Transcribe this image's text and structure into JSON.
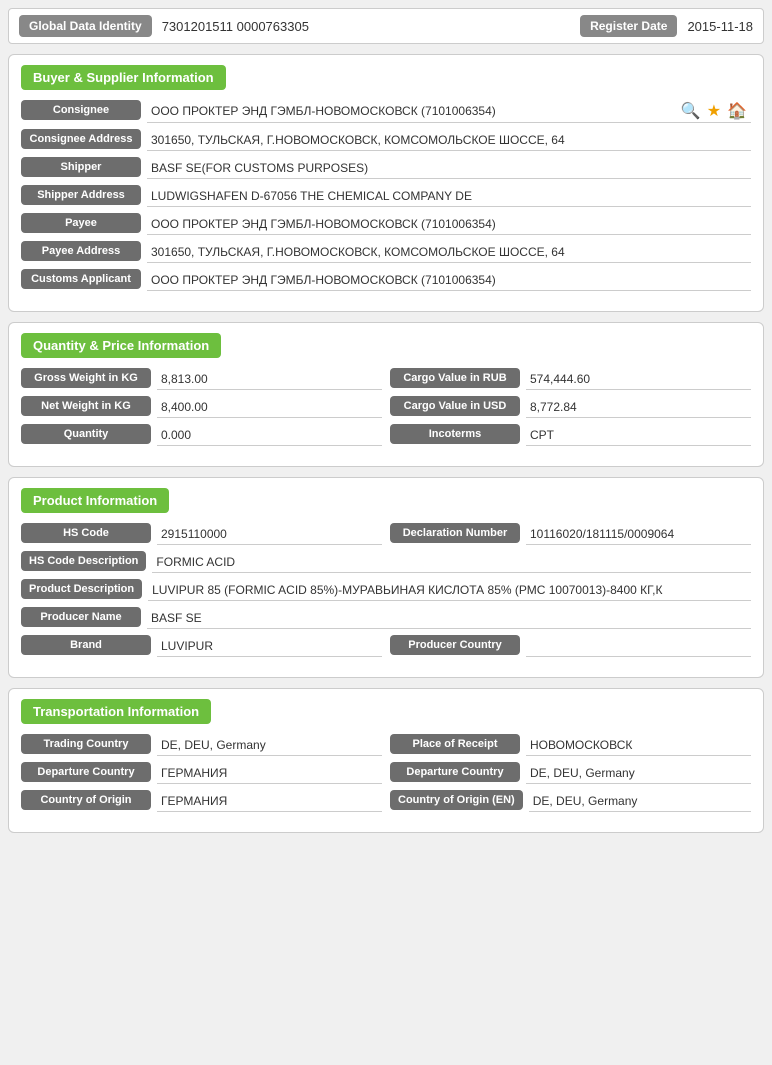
{
  "topBar": {
    "globalDataIdentityLabel": "Global Data Identity",
    "globalDataIdentityValue": "7301201511 0000763305",
    "registerDateLabel": "Register Date",
    "registerDateValue": "2015-11-18"
  },
  "buyerSupplier": {
    "sectionTitle": "Buyer & Supplier Information",
    "fields": [
      {
        "label": "Consignee",
        "value": "ООО ПРОКТЕР ЭНД ГЭМБЛ-НОВОМОСКОВСК (7101006354)"
      },
      {
        "label": "Consignee Address",
        "value": "301650, ТУЛЬСКАЯ, Г.НОВОМОСКОВСК, КОМСОМОЛЬСКОЕ ШОССЕ, 64"
      },
      {
        "label": "Shipper",
        "value": "BASF SE(FOR CUSTOMS PURPOSES)"
      },
      {
        "label": "Shipper Address",
        "value": "LUDWIGSHAFEN D-67056 THE CHEMICAL COMPANY DE"
      },
      {
        "label": "Payee",
        "value": "ООО ПРОКТЕР ЭНД ГЭМБЛ-НОВОМОСКОВСК (7101006354)"
      },
      {
        "label": "Payee Address",
        "value": "301650, ТУЛЬСКАЯ, Г.НОВОМОСКОВСК, КОМСОМОЛЬСКОЕ ШОССЕ, 64"
      },
      {
        "label": "Customs Applicant",
        "value": "ООО ПРОКТЕР ЭНД ГЭМБЛ-НОВОМОСКОВСК (7101006354)"
      }
    ]
  },
  "quantityPrice": {
    "sectionTitle": "Quantity & Price Information",
    "leftFields": [
      {
        "label": "Gross Weight in KG",
        "value": "8,813.00"
      },
      {
        "label": "Net Weight in KG",
        "value": "8,400.00"
      },
      {
        "label": "Quantity",
        "value": "0.000"
      }
    ],
    "rightFields": [
      {
        "label": "Cargo Value in RUB",
        "value": "574,444.60"
      },
      {
        "label": "Cargo Value in USD",
        "value": "8,772.84"
      },
      {
        "label": "Incoterms",
        "value": "CPT"
      }
    ]
  },
  "productInfo": {
    "sectionTitle": "Product Information",
    "topRow": {
      "leftLabel": "HS Code",
      "leftValue": "2915110000",
      "rightLabel": "Declaration Number",
      "rightValue": "10116020/181115/0009064"
    },
    "fields": [
      {
        "label": "HS Code Description",
        "value": "FORMIC ACID"
      },
      {
        "label": "Product Description",
        "value": "LUVIPUR 85 (FORMIC ACID 85%)-МУРАВЬИНАЯ КИСЛОТА 85% (РМС 10070013)-8400 КГ,К"
      },
      {
        "label": "Producer Name",
        "value": "BASF SE"
      }
    ],
    "bottomRow": {
      "leftLabel": "Brand",
      "leftValue": "LUVIPUR",
      "rightLabel": "Producer Country",
      "rightValue": ""
    }
  },
  "transportation": {
    "sectionTitle": "Transportation Information",
    "rows": [
      {
        "leftLabel": "Trading Country",
        "leftValue": "DE, DEU, Germany",
        "rightLabel": "Place of Receipt",
        "rightValue": "НОВОМОСКОВСК"
      },
      {
        "leftLabel": "Departure Country",
        "leftValue": "ГЕРМАНИЯ",
        "rightLabel": "Departure Country",
        "rightValue": "DE, DEU, Germany"
      },
      {
        "leftLabel": "Country of Origin",
        "leftValue": "ГЕРМАНИЯ",
        "rightLabel": "Country of Origin (EN)",
        "rightValue": "DE, DEU, Germany"
      }
    ]
  },
  "icons": {
    "search": "🔍",
    "star": "★",
    "home": "🏠"
  }
}
